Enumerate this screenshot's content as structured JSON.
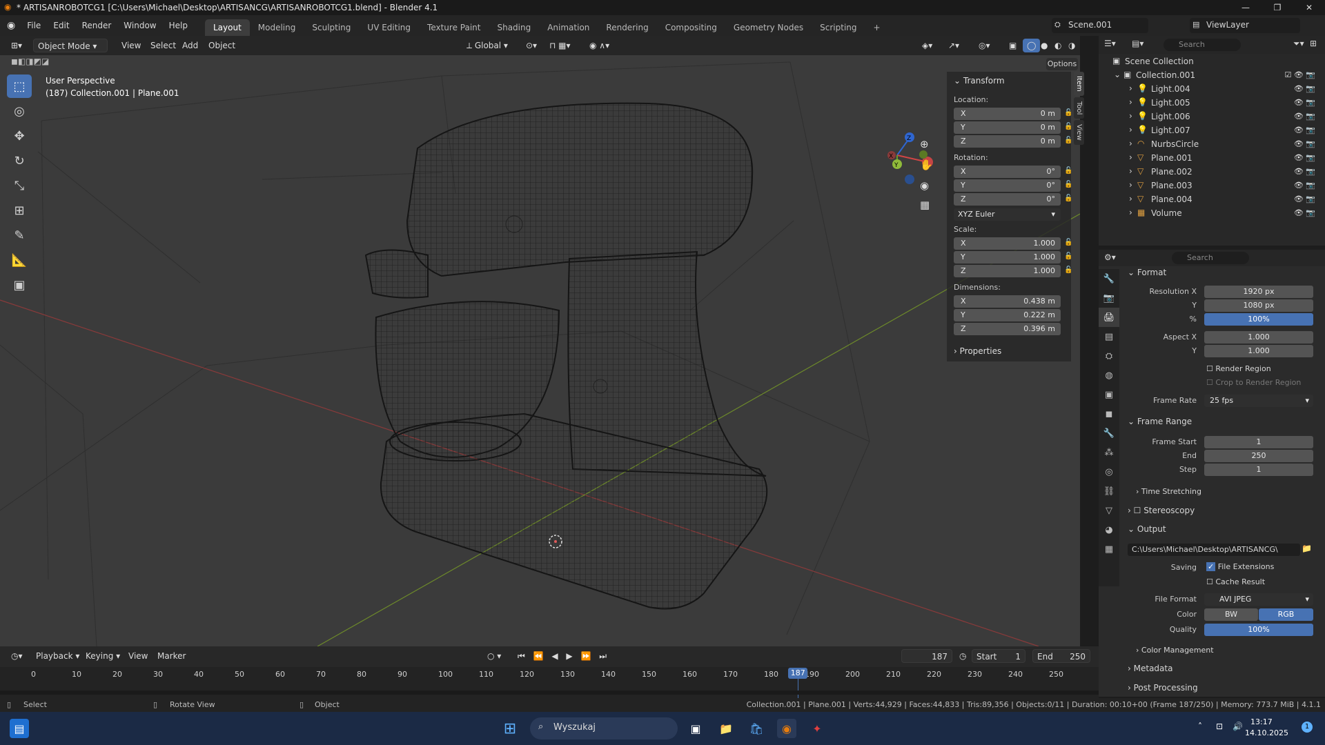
{
  "window": {
    "title": "* ARTISANROBOTCG1 [C:\\Users\\Michael\\Desktop\\ARTISANCG\\ARTISANROBOTCG1.blend] - Blender 4.1",
    "minimize": "—",
    "maximize": "❐",
    "close": "✕"
  },
  "menus": [
    "File",
    "Edit",
    "Render",
    "Window",
    "Help"
  ],
  "workspaces": [
    "Layout",
    "Modeling",
    "Sculpting",
    "UV Editing",
    "Texture Paint",
    "Shading",
    "Animation",
    "Rendering",
    "Compositing",
    "Geometry Nodes",
    "Scripting",
    "+"
  ],
  "active_workspace": "Layout",
  "scene": {
    "name": "Scene.001",
    "view_layer": "ViewLayer"
  },
  "viewport_header": {
    "mode": "Object Mode",
    "menus": [
      "View",
      "Select",
      "Add",
      "Object"
    ],
    "orientation": "Global",
    "options": "Options"
  },
  "viewport": {
    "perspective": "User Perspective",
    "collection_info": "(187) Collection.001 | Plane.001"
  },
  "gizmo_axes": {
    "x": "X",
    "y": "Y",
    "z": "Z"
  },
  "npanel": {
    "tabs": [
      "Item",
      "Tool",
      "View"
    ],
    "transform_label": "Transform",
    "location_label": "Location:",
    "location": [
      {
        "axis": "X",
        "value": "0 m"
      },
      {
        "axis": "Y",
        "value": "0 m"
      },
      {
        "axis": "Z",
        "value": "0 m"
      }
    ],
    "rotation_label": "Rotation:",
    "rotation": [
      {
        "axis": "X",
        "value": "0°"
      },
      {
        "axis": "Y",
        "value": "0°"
      },
      {
        "axis": "Z",
        "value": "0°"
      }
    ],
    "rotation_mode": "XYZ Euler",
    "scale_label": "Scale:",
    "scale": [
      {
        "axis": "X",
        "value": "1.000"
      },
      {
        "axis": "Y",
        "value": "1.000"
      },
      {
        "axis": "Z",
        "value": "1.000"
      }
    ],
    "dimensions_label": "Dimensions:",
    "dimensions": [
      {
        "axis": "X",
        "value": "0.438 m"
      },
      {
        "axis": "Y",
        "value": "0.222 m"
      },
      {
        "axis": "Z",
        "value": "0.396 m"
      }
    ],
    "properties_label": "Properties"
  },
  "outliner": {
    "search_placeholder": "Search",
    "scene_collection": "Scene Collection",
    "collection": "Collection.001",
    "items": [
      "Light.004",
      "Light.005",
      "Light.006",
      "Light.007",
      "NurbsCircle",
      "Plane.001",
      "Plane.002",
      "Plane.003",
      "Plane.004",
      "Volume"
    ]
  },
  "properties": {
    "search_placeholder": "Search",
    "format_label": "Format",
    "resolution_x_label": "Resolution X",
    "resolution_x": "1920 px",
    "y_label": "Y",
    "resolution_y": "1080 px",
    "percent_label": "%",
    "percent": "100%",
    "aspect_x_label": "Aspect X",
    "aspect_x": "1.000",
    "aspect_y": "1.000",
    "render_region": "Render Region",
    "crop_region": "Crop to Render Region",
    "frame_rate_label": "Frame Rate",
    "frame_rate": "25 fps",
    "frame_range_label": "Frame Range",
    "frame_start_label": "Frame Start",
    "frame_start": "1",
    "end_label": "End",
    "frame_end": "250",
    "step_label": "Step",
    "step": "1",
    "time_stretching": "Time Stretching",
    "stereoscopy": "Stereoscopy",
    "output_label": "Output",
    "output_path": "C:\\Users\\Michael\\Desktop\\ARTISANCG\\",
    "saving_label": "Saving",
    "file_extensions": "File Extensions",
    "cache_result": "Cache Result",
    "file_format_label": "File Format",
    "file_format": "AVI JPEG",
    "color_label": "Color",
    "bw": "BW",
    "rgb": "RGB",
    "quality_label": "Quality",
    "quality": "100%",
    "color_management": "Color Management",
    "metadata": "Metadata",
    "post_processing": "Post Processing"
  },
  "timeline": {
    "menus": [
      "Playback",
      "Keying",
      "View",
      "Marker"
    ],
    "current_frame": "187",
    "start_label": "Start",
    "start": "1",
    "end_label": "End",
    "end": "250",
    "ticks": [
      "0",
      "10",
      "20",
      "30",
      "40",
      "50",
      "60",
      "70",
      "80",
      "90",
      "100",
      "110",
      "120",
      "130",
      "140",
      "150",
      "160",
      "170",
      "180",
      "190",
      "200",
      "210",
      "220",
      "230",
      "240",
      "250"
    ],
    "playhead": "187"
  },
  "statusbar": {
    "select": "Select",
    "rotate": "Rotate View",
    "object": "Object",
    "stats": "Collection.001 | Plane.001 | Verts:44,929 | Faces:44,833 | Tris:89,356 | Objects:0/11 | Duration: 00:10+00 (Frame 187/250) | Memory: 773.7 MiB | 4.1.1"
  },
  "taskbar": {
    "search": "Wyszukaj",
    "time": "13:17",
    "date": "14.10.2025",
    "notif": "1"
  }
}
